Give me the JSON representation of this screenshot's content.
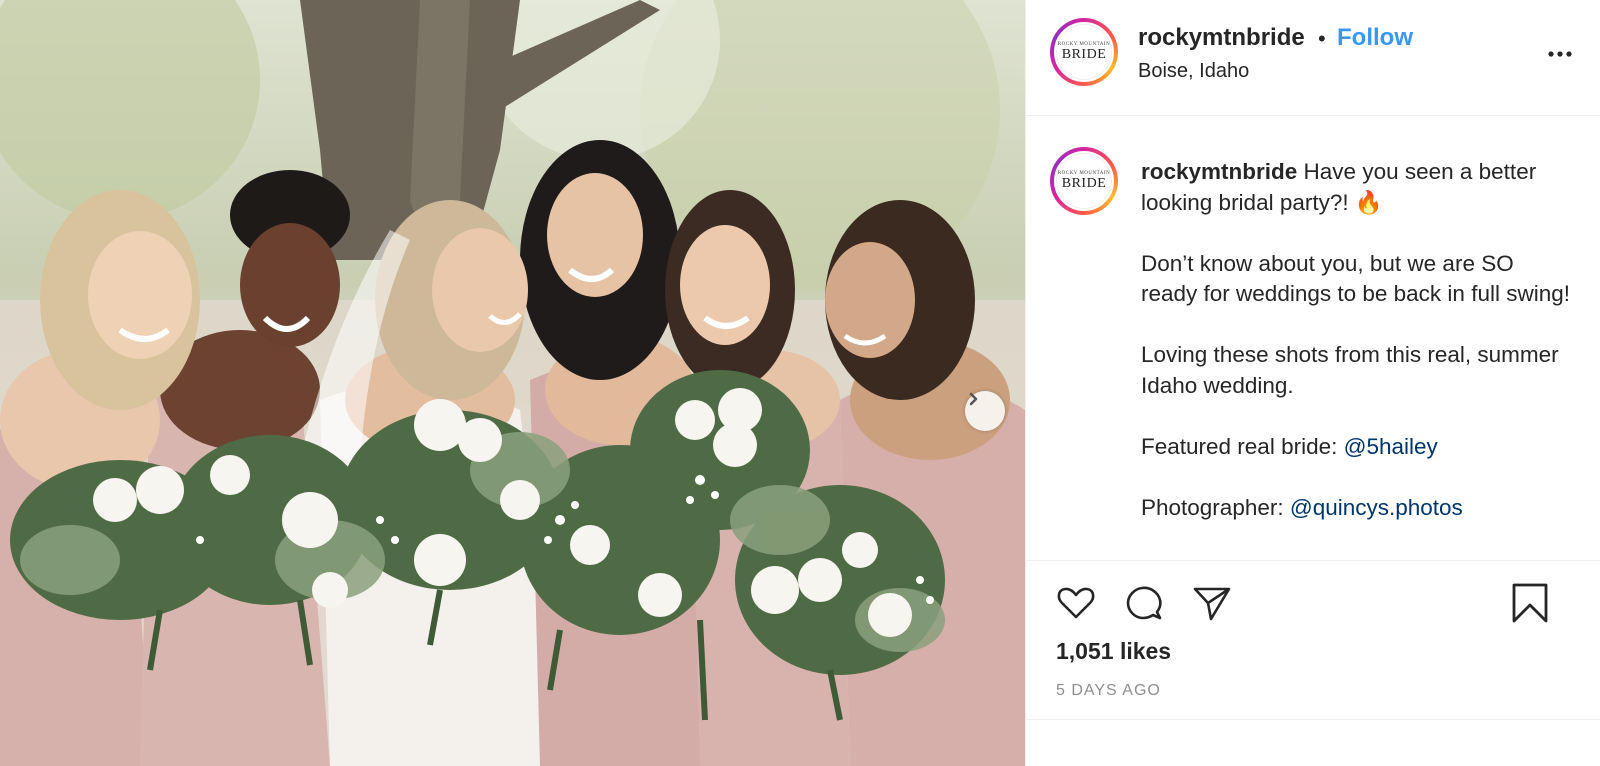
{
  "post": {
    "next_icon": "chevron-right-icon"
  },
  "header": {
    "avatar": {
      "small_text": "ROCKY MOUNTAIN",
      "big_text": "BRIDE"
    },
    "username": "rockymtnbride",
    "separator": "•",
    "follow_label": "Follow",
    "location": "Boise, Idaho",
    "more_icon": "more-horizontal-icon"
  },
  "caption": {
    "username": "rockymtnbride",
    "text_1": " Have you seen a better looking bridal party?! 🔥\n\nDon’t know about you, but we are SO ready for weddings to be back in full swing!\n\nLoving these shots from this real, summer Idaho wedding.\n\nFeatured real bride: ",
    "mention_bride": "@5hailey",
    "text_2": "\n\nPhotographer: ",
    "mention_photographer": "@quincys.photos"
  },
  "actions": {
    "like_icon": "heart-icon",
    "comment_icon": "comment-icon",
    "share_icon": "share-icon",
    "save_icon": "bookmark-icon",
    "likes": "1,051 likes",
    "date": "5 DAYS AGO"
  },
  "colors": {
    "follow": "#3897f0",
    "mention": "#003569",
    "muted": "#8e8e8e",
    "text": "#262626"
  }
}
